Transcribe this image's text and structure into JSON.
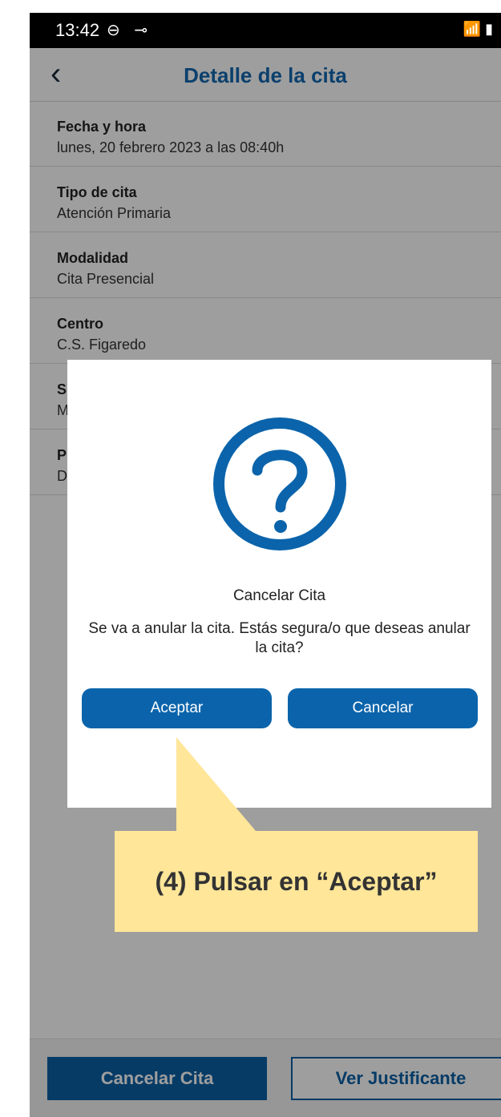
{
  "status_bar": {
    "time": "13:42",
    "left_icons": "⊖ ⊸",
    "right_icons": "📶 ▮"
  },
  "header": {
    "title": "Detalle de la cita"
  },
  "fields": [
    {
      "label": "Fecha y hora",
      "value": "lunes, 20 febrero 2023 a las 08:40h"
    },
    {
      "label": "Tipo de cita",
      "value": "Atención Primaria"
    },
    {
      "label": "Modalidad",
      "value": "Cita Presencial"
    },
    {
      "label": "Centro",
      "value": "C.S. Figaredo"
    },
    {
      "label": "S",
      "value": "M"
    },
    {
      "label": "P",
      "value": "D"
    }
  ],
  "bottom": {
    "cancel_label": "Cancelar Cita",
    "justificante_label": "Ver Justificante"
  },
  "dialog": {
    "title": "Cancelar Cita",
    "message": "Se va a anular la cita. Estás segura/o que deseas anular la cita?",
    "accept_label": "Aceptar",
    "cancel_label": "Cancelar"
  },
  "annotation": {
    "text": "(4) Pulsar en “Aceptar”"
  },
  "colors": {
    "brand_blue": "#0b64ab",
    "callout_yellow": "#ffe699"
  }
}
